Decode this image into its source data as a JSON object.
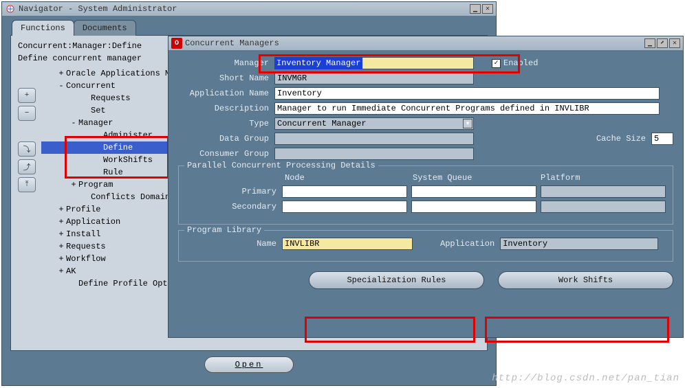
{
  "navigator": {
    "title": "Navigator - System Administrator",
    "tabs": {
      "functions": "Functions",
      "documents": "Documents"
    },
    "breadcrumb": "Concurrent:Manager:Define",
    "description": "Define concurrent manager",
    "open_btn": "Open",
    "toolbar_icons": {
      "plus": "+",
      "minus": "−",
      "expand_one": "⤵",
      "expand_all": "⤴",
      "collapse": "⤒"
    },
    "tree": [
      {
        "ind": 1,
        "tog": "+",
        "label": "Oracle Applications Manager"
      },
      {
        "ind": 1,
        "tog": "-",
        "label": "Concurrent"
      },
      {
        "ind": 3,
        "tog": "",
        "label": "Requests"
      },
      {
        "ind": 3,
        "tog": "",
        "label": "Set"
      },
      {
        "ind": 2,
        "tog": "-",
        "label": "Manager"
      },
      {
        "ind": 4,
        "tog": "",
        "label": "Administer"
      },
      {
        "ind": 4,
        "tog": "",
        "label": "Define",
        "selected": true
      },
      {
        "ind": 4,
        "tog": "",
        "label": "WorkShifts"
      },
      {
        "ind": 4,
        "tog": "",
        "label": "Rule"
      },
      {
        "ind": 2,
        "tog": "+",
        "label": "Program"
      },
      {
        "ind": 3,
        "tog": "",
        "label": "Conflicts Domains"
      },
      {
        "ind": 1,
        "tog": "+",
        "label": "Profile"
      },
      {
        "ind": 1,
        "tog": "+",
        "label": "Application"
      },
      {
        "ind": 1,
        "tog": "+",
        "label": "Install"
      },
      {
        "ind": 1,
        "tog": "+",
        "label": "Requests"
      },
      {
        "ind": 1,
        "tog": "+",
        "label": "Workflow"
      },
      {
        "ind": 1,
        "tog": "+",
        "label": "AK"
      },
      {
        "ind": 2,
        "tog": "",
        "label": "Define Profile Options"
      }
    ]
  },
  "cm": {
    "title": "Concurrent Managers",
    "labels": {
      "manager": "Manager",
      "short_name": "Short Name",
      "application_name": "Application Name",
      "description": "Description",
      "type": "Type",
      "data_group": "Data Group",
      "consumer_group": "Consumer Group",
      "cache_size": "Cache Size",
      "enabled": "Enabled",
      "pcp_legend": "Parallel Concurrent Processing Details",
      "node": "Node",
      "system_queue": "System Queue",
      "platform": "Platform",
      "primary": "Primary",
      "secondary": "Secondary",
      "library_legend": "Program Library",
      "name": "Name",
      "application": "Application",
      "spec_rules": "Specialization Rules",
      "work_shifts": "Work Shifts"
    },
    "values": {
      "manager": "Inventory Manager",
      "short_name": "INVMGR",
      "application_name": "Inventory",
      "description": "Manager to run Immediate Concurrent Programs defined in INVLIBR",
      "type": "Concurrent Manager",
      "data_group": "",
      "consumer_group": "",
      "cache_size": "5",
      "enabled_checked": "✓",
      "primary_node": "",
      "primary_queue": "",
      "primary_platform": "",
      "secondary_node": "",
      "secondary_queue": "",
      "secondary_platform": "",
      "lib_name": "INVLIBR",
      "lib_application": "Inventory"
    }
  },
  "watermark": "http://blog.csdn.net/pan_tian"
}
